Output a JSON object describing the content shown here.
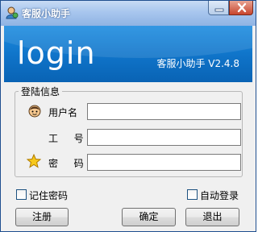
{
  "window": {
    "title": "客服小助手"
  },
  "banner": {
    "heading": "login",
    "version": "客服小助手 V2.4.8"
  },
  "login_group": {
    "title": "登陆信息",
    "username_label": "用户名",
    "employee_id_label": "工  号",
    "password_label": "密  码",
    "username_value": "",
    "employee_id_value": "",
    "password_value": ""
  },
  "options": {
    "remember_password": "记住密码",
    "auto_login": "自动登录"
  },
  "buttons": {
    "register": "注册",
    "confirm": "确定",
    "exit": "退出"
  },
  "icons": {
    "app": "app-user-icon",
    "user": "user-face-icon",
    "password": "star-icon"
  },
  "colors": {
    "banner": "#0f73c8",
    "titlebar": "#a8c6ee",
    "close": "#c8452d"
  }
}
